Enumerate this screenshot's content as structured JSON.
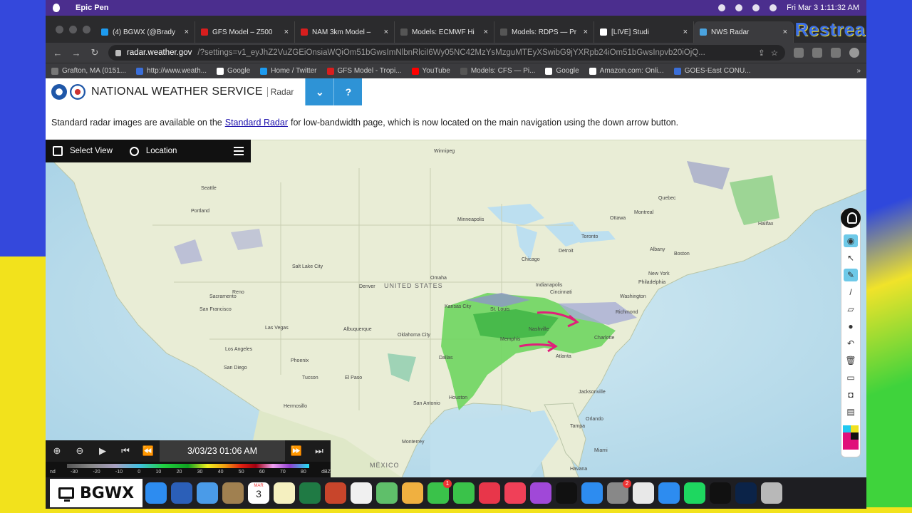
{
  "menubar": {
    "app_name": "Epic Pen",
    "clock": "Fri Mar 3  1:11:32 AM"
  },
  "browser": {
    "tabs": [
      {
        "label": "(4) BGWX (@Brady",
        "color": "#1d9bf0",
        "active": false
      },
      {
        "label": "GFS Model – Z500",
        "color": "#d81e1e",
        "active": false
      },
      {
        "label": "NAM 3km Model –",
        "color": "#d81e1e",
        "active": false
      },
      {
        "label": "Models: ECMWF Hi",
        "color": "#555555",
        "active": false
      },
      {
        "label": "Models: RDPS — Pr",
        "color": "#555555",
        "active": false
      },
      {
        "label": "[LIVE] Studi",
        "color": "#ffffff",
        "active": false
      },
      {
        "label": "NWS Radar",
        "color": "#4aa3df",
        "active": true
      }
    ],
    "brand_overlay": "Restream",
    "url_host": "radar.weather.gov",
    "url_path": "/?settings=v1_eyJhZ2VuZGEiOnsiaWQiOm51bGwsImNlbnRlciI6Wy05NC42MzYsMzguMTEyXSwibG9jYXRpb24iOm51bGwsInpvb20iOjQ...",
    "bookmarks": [
      {
        "label": "Grafton, MA (0151...",
        "color": "#777777"
      },
      {
        "label": "http://www.weath...",
        "color": "#3a6ed8"
      },
      {
        "label": "Google",
        "color": "#ffffff"
      },
      {
        "label": "Home / Twitter",
        "color": "#1d9bf0"
      },
      {
        "label": "GFS Model - Tropi...",
        "color": "#d81e1e"
      },
      {
        "label": "YouTube",
        "color": "#ff0000"
      },
      {
        "label": "Models: CFS — Pi...",
        "color": "#555555"
      },
      {
        "label": "Google",
        "color": "#ffffff"
      },
      {
        "label": "Amazon.com: Onli...",
        "color": "#ffffff"
      },
      {
        "label": "GOES-East CONU...",
        "color": "#3a6ed8"
      }
    ],
    "bookmarks_more": "»"
  },
  "page": {
    "site_title": "NATIONAL WEATHER SERVICE",
    "site_sub": "Radar",
    "notice_before": "Standard radar images are available on the",
    "notice_link": "Standard Radar",
    "notice_after": "for low-bandwidth page, which is now located on the main navigation using the down arrow button.",
    "mapbar": {
      "select_view": "Select View",
      "location": "Location"
    },
    "player": {
      "time": "3/03/23 01:06 AM"
    },
    "legend_ticks": [
      "nd",
      "-30",
      "-20",
      "-10",
      "0",
      "10",
      "20",
      "30",
      "40",
      "50",
      "60",
      "70",
      "80",
      "dBZ"
    ],
    "map_labels": {
      "country_us": "UNITED STATES",
      "country_mx": "MÉXICO",
      "cities": [
        "Winnipeg",
        "Minneapolis",
        "Chicago",
        "Detroit",
        "Toronto",
        "Montreal",
        "Ottawa",
        "Albany",
        "Boston",
        "New York",
        "Philadelphia",
        "Washington",
        "Richmond",
        "Indianapolis",
        "Cincinnati",
        "Nashville",
        "Memphis",
        "Atlanta",
        "Charlotte",
        "Jacksonville",
        "Orlando",
        "Miami",
        "Tampa",
        "Dallas",
        "Houston",
        "San Antonio",
        "Oklahoma City",
        "Denver",
        "Salt Lake City",
        "Las Vegas",
        "Phoenix",
        "Los Angeles",
        "San Diego",
        "San Francisco",
        "Sacramento",
        "Reno",
        "Seattle",
        "Portland",
        "El Paso",
        "Albuquerque",
        "Tucson",
        "Hermosillo",
        "Monterrey",
        "Havana",
        "Kansas City",
        "St. Louis",
        "Omaha",
        "Halifax",
        "Quebec"
      ]
    }
  },
  "bgwx_label": "BGWX",
  "dock_apps": [
    {
      "name": "safari",
      "color": "#2d8cf0"
    },
    {
      "name": "word",
      "color": "#2b5fb8"
    },
    {
      "name": "mail",
      "color": "#4a9be8"
    },
    {
      "name": "notes-brown",
      "color": "#a08050"
    },
    {
      "name": "calendar",
      "color": "#ffffff"
    },
    {
      "name": "notes",
      "color": "#f5f0c0"
    },
    {
      "name": "excel",
      "color": "#1f7a44"
    },
    {
      "name": "powerpoint",
      "color": "#c8452b"
    },
    {
      "name": "reminders",
      "color": "#f0f0f0"
    },
    {
      "name": "maps",
      "color": "#5fbf6a"
    },
    {
      "name": "photos",
      "color": "#f0b040"
    },
    {
      "name": "messages",
      "color": "#3ac24a",
      "badge": "1"
    },
    {
      "name": "facetime",
      "color": "#3ac24a"
    },
    {
      "name": "news",
      "color": "#e8364a"
    },
    {
      "name": "music",
      "color": "#f04058"
    },
    {
      "name": "podcasts",
      "color": "#a048d8"
    },
    {
      "name": "tv",
      "color": "#111111"
    },
    {
      "name": "app-store",
      "color": "#2d8cf0"
    },
    {
      "name": "system-settings",
      "color": "#888888",
      "badge": "2"
    },
    {
      "name": "chrome",
      "color": "#e8e8e8"
    },
    {
      "name": "bluetooth",
      "color": "#2d8cf0"
    },
    {
      "name": "spotify",
      "color": "#1ed760"
    },
    {
      "name": "epic-pen",
      "color": "#111111"
    },
    {
      "name": "photoshop",
      "color": "#0b2348"
    },
    {
      "name": "trash",
      "color": "#b8b8b8"
    }
  ],
  "calendar_day": "3",
  "calendar_month": "MAR",
  "colors": {
    "nws_blue": "#2e93d6",
    "radar_green": "#5fd35a",
    "annotation_pink": "#e0207a"
  }
}
